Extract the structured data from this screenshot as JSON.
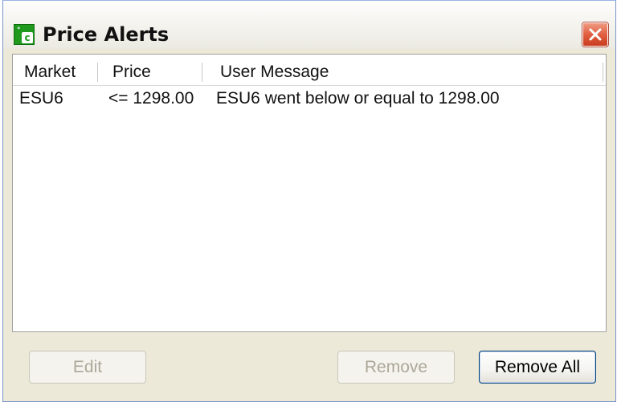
{
  "window": {
    "title": "Price Alerts",
    "app_icon_text": "°c"
  },
  "list": {
    "columns": [
      "Market",
      "Price",
      "User Message"
    ],
    "rows": [
      {
        "market": "ESU6",
        "price": "<= 1298.00",
        "message": "ESU6 went below or equal to 1298.00"
      }
    ]
  },
  "buttons": {
    "edit": "Edit",
    "remove": "Remove",
    "remove_all": "Remove All"
  },
  "colors": {
    "close_button": "#e05a3c",
    "app_icon": "#1f9a1f",
    "disabled_text": "#aca899",
    "focus_border": "#003c74"
  },
  "icons": {
    "app": "app-logo-icon",
    "close": "close-icon"
  }
}
